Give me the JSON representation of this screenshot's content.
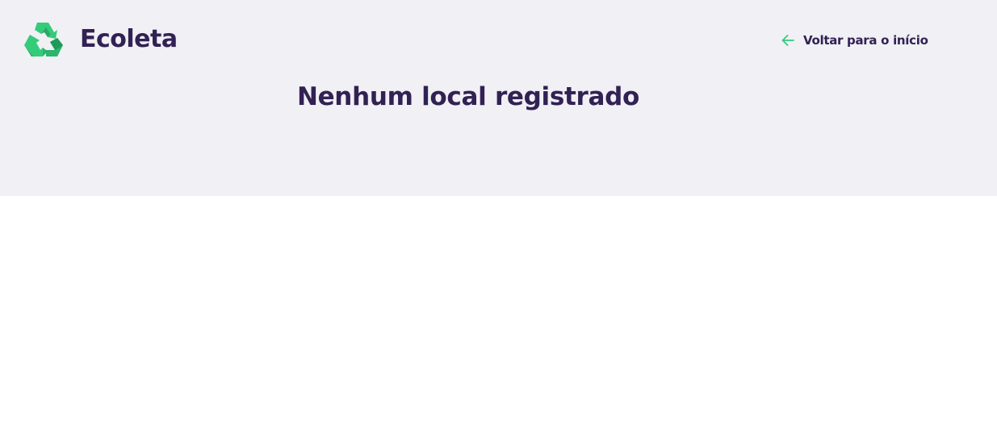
{
  "header": {
    "logo_icon": "recycle-icon",
    "app_name": "Ecoleta",
    "back_link": {
      "icon": "arrow-left-icon",
      "label": "Voltar para o início"
    }
  },
  "main": {
    "title": "Nenhum local registrado"
  },
  "colors": {
    "background_top": "#f0f0f5",
    "background_page": "#ffffff",
    "text_primary": "#322153",
    "accent": "#34cb79"
  }
}
